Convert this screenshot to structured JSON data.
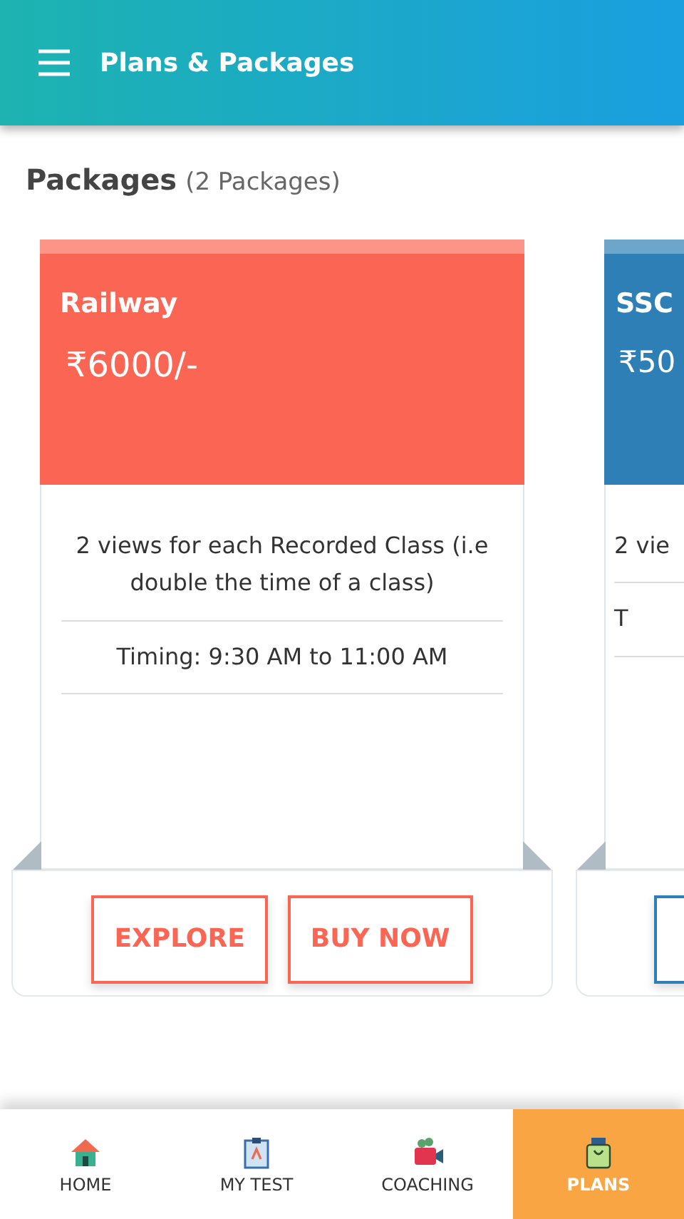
{
  "app_bar": {
    "title": "Plans & Packages"
  },
  "section": {
    "title": "Packages",
    "count": "(2 Packages)"
  },
  "packages": [
    {
      "name": "Railway",
      "price": "₹6000/-",
      "color": "#fb6654",
      "features": [
        "2 views for each Recorded Class (i.e double the time of a class)",
        "Timing: 9:30 AM to 11:00 AM"
      ],
      "buttons": [
        "EXPLORE",
        "BUY NOW"
      ]
    },
    {
      "name": "SSC",
      "price": "₹50",
      "color": "#2e7fb5",
      "features": [
        "2 vie",
        "T"
      ]
    }
  ],
  "bottom_nav": [
    {
      "label": "HOME",
      "kind": "home",
      "selected": false
    },
    {
      "label": "MY TEST",
      "kind": "test",
      "selected": false
    },
    {
      "label": "COACHING",
      "kind": "coaching",
      "selected": false
    },
    {
      "label": "PLANS",
      "kind": "plans",
      "selected": true
    }
  ]
}
